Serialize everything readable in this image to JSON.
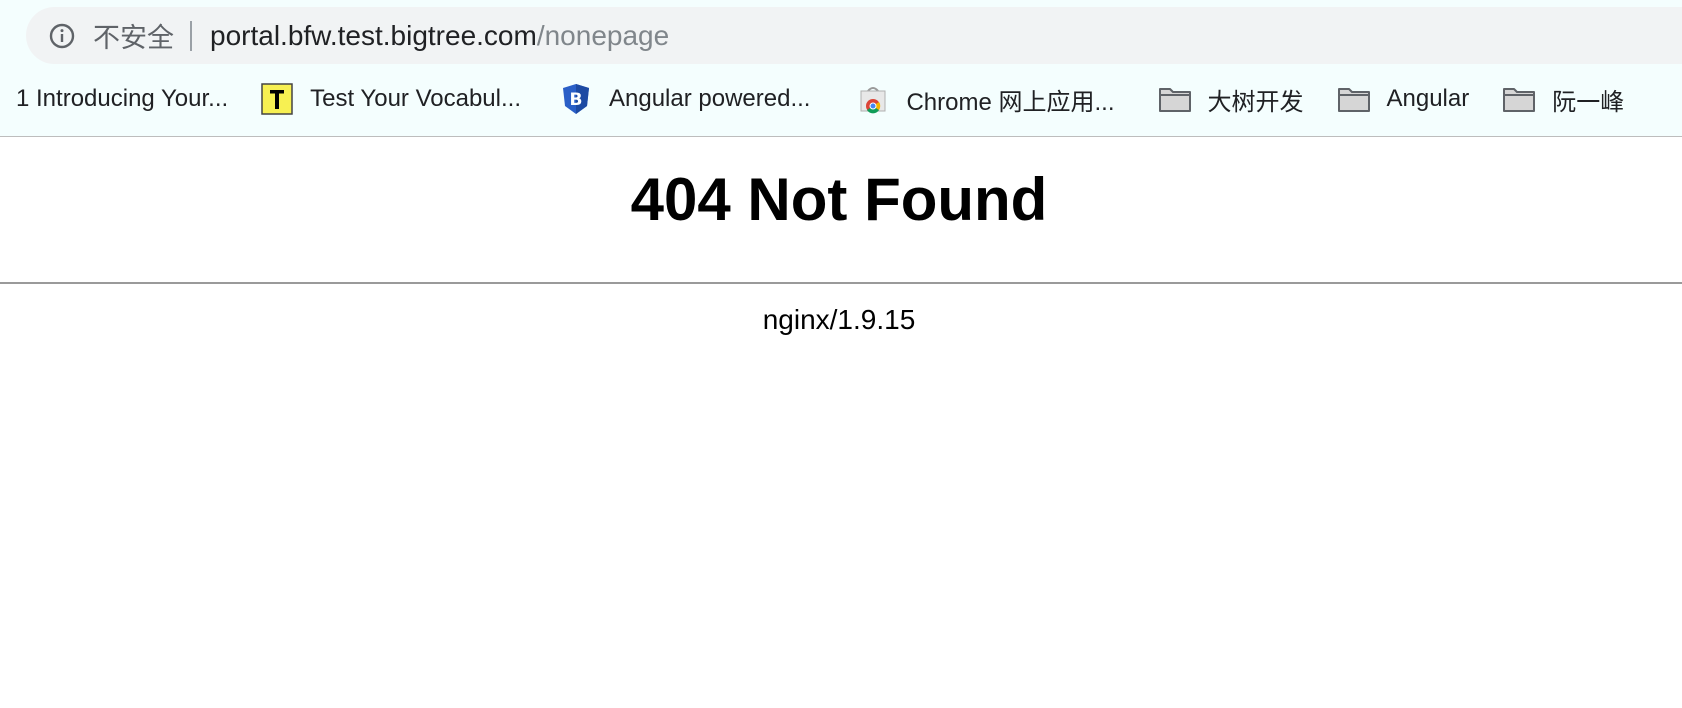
{
  "browser": {
    "security_label": "不安全",
    "url_host": "portal.bfw.test.bigtree.com",
    "url_path": "/nonepage"
  },
  "bookmarks": [
    {
      "label": "1 Introducing Your...",
      "icon": "none"
    },
    {
      "label": "Test Your Vocabul...",
      "icon": "t-badge-icon"
    },
    {
      "label": "Angular powered...",
      "icon": "bootstrap-shield-icon"
    },
    {
      "label": "Chrome 网上应用...",
      "icon": "chrome-web-store-icon"
    },
    {
      "label": "大树开发",
      "icon": "folder-icon"
    },
    {
      "label": "Angular",
      "icon": "folder-icon"
    },
    {
      "label": "阮一峰",
      "icon": "folder-icon"
    }
  ],
  "page": {
    "heading": "404 Not Found",
    "server": "nginx/1.9.15"
  },
  "colors": {
    "toolbar_bg": "#f4fefe",
    "omnibox_bg": "#f1f3f4",
    "url_path": "#80868b",
    "bootstrap_blue": "#2a5fc7",
    "t_badge_yellow": "#f7f052"
  }
}
